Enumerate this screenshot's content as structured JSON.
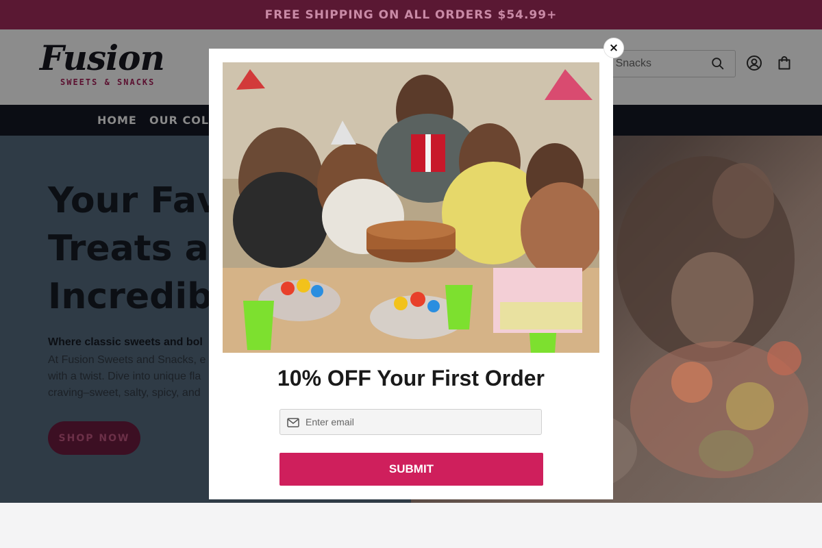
{
  "announcement": {
    "text": "FREE SHIPPING ON ALL ORDERS $54.99+"
  },
  "brand": {
    "name": "Fusion",
    "tagline": "SWEETS & SNACKS"
  },
  "search": {
    "placeholder_visible": "s & Snacks"
  },
  "header_icons": [
    "search-icon",
    "account-icon",
    "cart-icon"
  ],
  "nav": {
    "items": [
      {
        "label": "HOME"
      },
      {
        "label": "OUR COLL"
      }
    ]
  },
  "hero": {
    "headline_lines": [
      "Your Favo",
      "Treats at",
      "Incredibl"
    ],
    "lead": "Where classic sweets and bol",
    "body_lines": [
      "At Fusion Sweets and Snacks, e",
      "with a twist. Dive into unique fla",
      "craving–sweet, salty, spicy, and"
    ],
    "cta_label": "SHOP NOW"
  },
  "popup": {
    "heading": "10% OFF Your First Order",
    "email_placeholder": "Enter email",
    "submit_label": "SUBMIT",
    "close_label": "×"
  },
  "colors": {
    "announcement_bg": "#5a1833",
    "nav_bg": "#0b0d14",
    "submit_bg": "#cf1f5c",
    "brand_accent": "#5b1030"
  }
}
